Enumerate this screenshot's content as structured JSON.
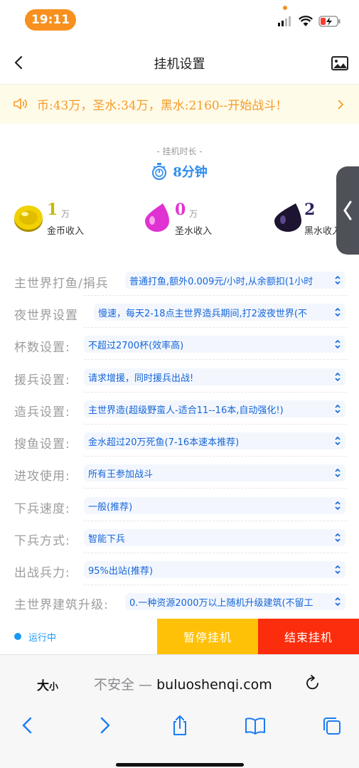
{
  "status_bar": {
    "time": "19:11"
  },
  "header": {
    "title": "挂机设置"
  },
  "notice": {
    "text": "币:43万，圣水:34万，黑水:2160--开始战斗!"
  },
  "duration": {
    "label": "- 挂机时长 -",
    "value": "8分钟"
  },
  "income": [
    {
      "amount": "1",
      "unit": "万",
      "label": "金币收入",
      "color": "#c8b800"
    },
    {
      "amount": "0",
      "unit": "万",
      "label": "圣水收入",
      "color": "#e036d0"
    },
    {
      "amount": "2",
      "unit": "",
      "label": "黑水收入",
      "color": "#2d2060"
    }
  ],
  "settings": [
    {
      "label": "主世界打鱼/捐兵",
      "value": "普通打鱼,额外0.009元/小时,从余额扣(1小时"
    },
    {
      "label": "夜世界设置",
      "value": "慢速，每天2-18点主世界造兵期间,打2波夜世界(不"
    },
    {
      "label": "杯数设置:",
      "value": "不超过2700杯(效率高)"
    },
    {
      "label": "援兵设置:",
      "value": "请求增援，同时援兵出战!"
    },
    {
      "label": "造兵设置:",
      "value": "主世界造(超级野蛮人-适合11--16本,自动强化!)"
    },
    {
      "label": "搜鱼设置:",
      "value": "金水超过20万死鱼(7-16本速本推荐)"
    },
    {
      "label": "进攻使用:",
      "value": "所有王参加战斗"
    },
    {
      "label": "下兵速度:",
      "value": "一般(推荐)"
    },
    {
      "label": "下兵方式:",
      "value": "智能下兵"
    },
    {
      "label": "出战兵力:",
      "value": "95%出站(推荐)"
    },
    {
      "label": "主世界建筑升级:",
      "value": "0.一种资源2000万以上随机升级建筑(不留工"
    }
  ],
  "bottom_bar": {
    "status": "运行中",
    "pause": "暂停挂机",
    "end": "结束挂机"
  },
  "browser": {
    "aa_big": "大",
    "aa_small": "小",
    "insecure": "不安全 — ",
    "domain": "buluoshenqi.com"
  },
  "colors": {
    "accent": "#f7901e",
    "blue": "#2f8cf0",
    "pause": "#ffc107",
    "end": "#fb2d0c"
  }
}
